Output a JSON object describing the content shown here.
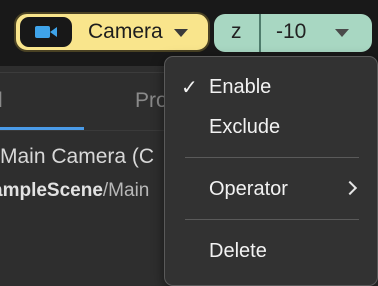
{
  "toolbar": {
    "camera_label": "Camera",
    "axis_label": "z",
    "axis_value": "-10"
  },
  "panel": {
    "tab_left": "l",
    "tab_right": "Pro",
    "object_name": "Main Camera (C",
    "path_prefix": "ampleScene",
    "path_suffix": "/Main"
  },
  "menu": {
    "items": [
      {
        "label": "Enable",
        "checked": true
      },
      {
        "label": "Exclude"
      },
      {
        "label": "Operator",
        "submenu": true
      },
      {
        "label": "Delete"
      }
    ]
  },
  "colors": {
    "camera_pill": "#f9e58c",
    "axis_pill": "#a8d7c2",
    "tab_accent": "#4a9be8"
  },
  "icons": [
    "camera-icon",
    "chevron-down-icon",
    "check-icon",
    "chevron-right-icon"
  ]
}
